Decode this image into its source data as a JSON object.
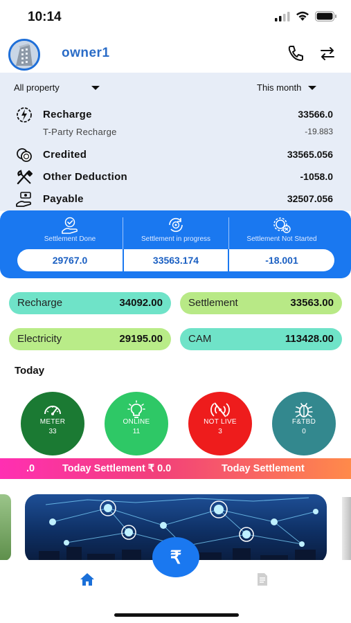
{
  "status": {
    "time": "10:14"
  },
  "header": {
    "username": "owner1"
  },
  "filters": {
    "property": "All property",
    "period": "This month"
  },
  "summary": {
    "recharge": {
      "label": "Recharge",
      "value": "33566.0"
    },
    "tparty": {
      "label": "T-Party Recharge",
      "value": "-19.883"
    },
    "credited": {
      "label": "Credited",
      "value": "33565.056"
    },
    "other_deduction": {
      "label": "Other Deduction",
      "value": "-1058.0"
    },
    "payable": {
      "label": "Payable",
      "value": "32507.056"
    }
  },
  "settlement": {
    "done": {
      "label": "Settlement Done",
      "value": "29767.0"
    },
    "in_progress": {
      "label": "Settlement in progress",
      "value": "33563.174"
    },
    "not_started": {
      "label": "Settlement Not Started",
      "value": "-18.001"
    }
  },
  "pills": {
    "recharge": {
      "label": "Recharge",
      "value": "34092.00"
    },
    "settlement": {
      "label": "Settlement",
      "value": "33563.00"
    },
    "electricity": {
      "label": "Electricity",
      "value": "29195.00"
    },
    "cam": {
      "label": "CAM",
      "value": "113428.00"
    }
  },
  "today": {
    "title": "Today",
    "meter": {
      "label": "METER",
      "count": "33"
    },
    "online": {
      "label": "ONLINE",
      "count": "11"
    },
    "not_live": {
      "label": "NOT LIVE",
      "count": "3"
    },
    "ftbd": {
      "label": "F&TBD",
      "count": "0"
    }
  },
  "marquee": {
    "part1": ".0",
    "part2": "Today Settlement ₹ 0.0",
    "part3": "Today Settlement"
  },
  "fab": {
    "symbol": "₹"
  },
  "colors": {
    "primary": "#1a78f0",
    "header_blue": "#2a6cc7",
    "summary_bg": "#e7edf7",
    "meter": "#1b7a33",
    "online": "#2ec866",
    "not_live": "#ee1c1c",
    "ftbd": "#33888e",
    "pill_recharge": "#6fe3c8",
    "pill_settlement": "#b8e986",
    "pill_electricity": "#b9ec88",
    "pill_cam": "#6fe3c8"
  }
}
